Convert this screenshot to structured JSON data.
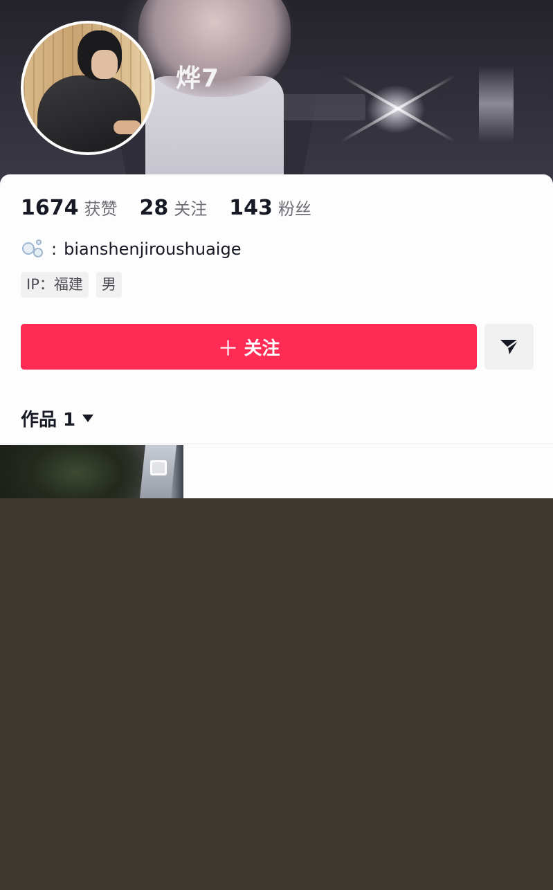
{
  "profile": {
    "nickname": "烨7",
    "stats": [
      {
        "value": "1674",
        "label": "获赞"
      },
      {
        "value": "28",
        "label": "关注"
      },
      {
        "value": "143",
        "label": "粉丝"
      }
    ],
    "bio": {
      "icon": "bubbles-icon",
      "separator": ":",
      "text": "bianshenjiroushuaige"
    },
    "tags": [
      "IP：福建",
      "男"
    ]
  },
  "actions": {
    "follow_plus": "＋",
    "follow_label": "关注",
    "share_icon": "send-icon"
  },
  "works": {
    "tab_label": "作品 1"
  },
  "colors": {
    "accent": "#fe2c55",
    "text_primary": "#161823",
    "text_secondary": "#6f7077",
    "tag_bg": "#f1f1f2",
    "bottom_bg": "#3c382e"
  }
}
